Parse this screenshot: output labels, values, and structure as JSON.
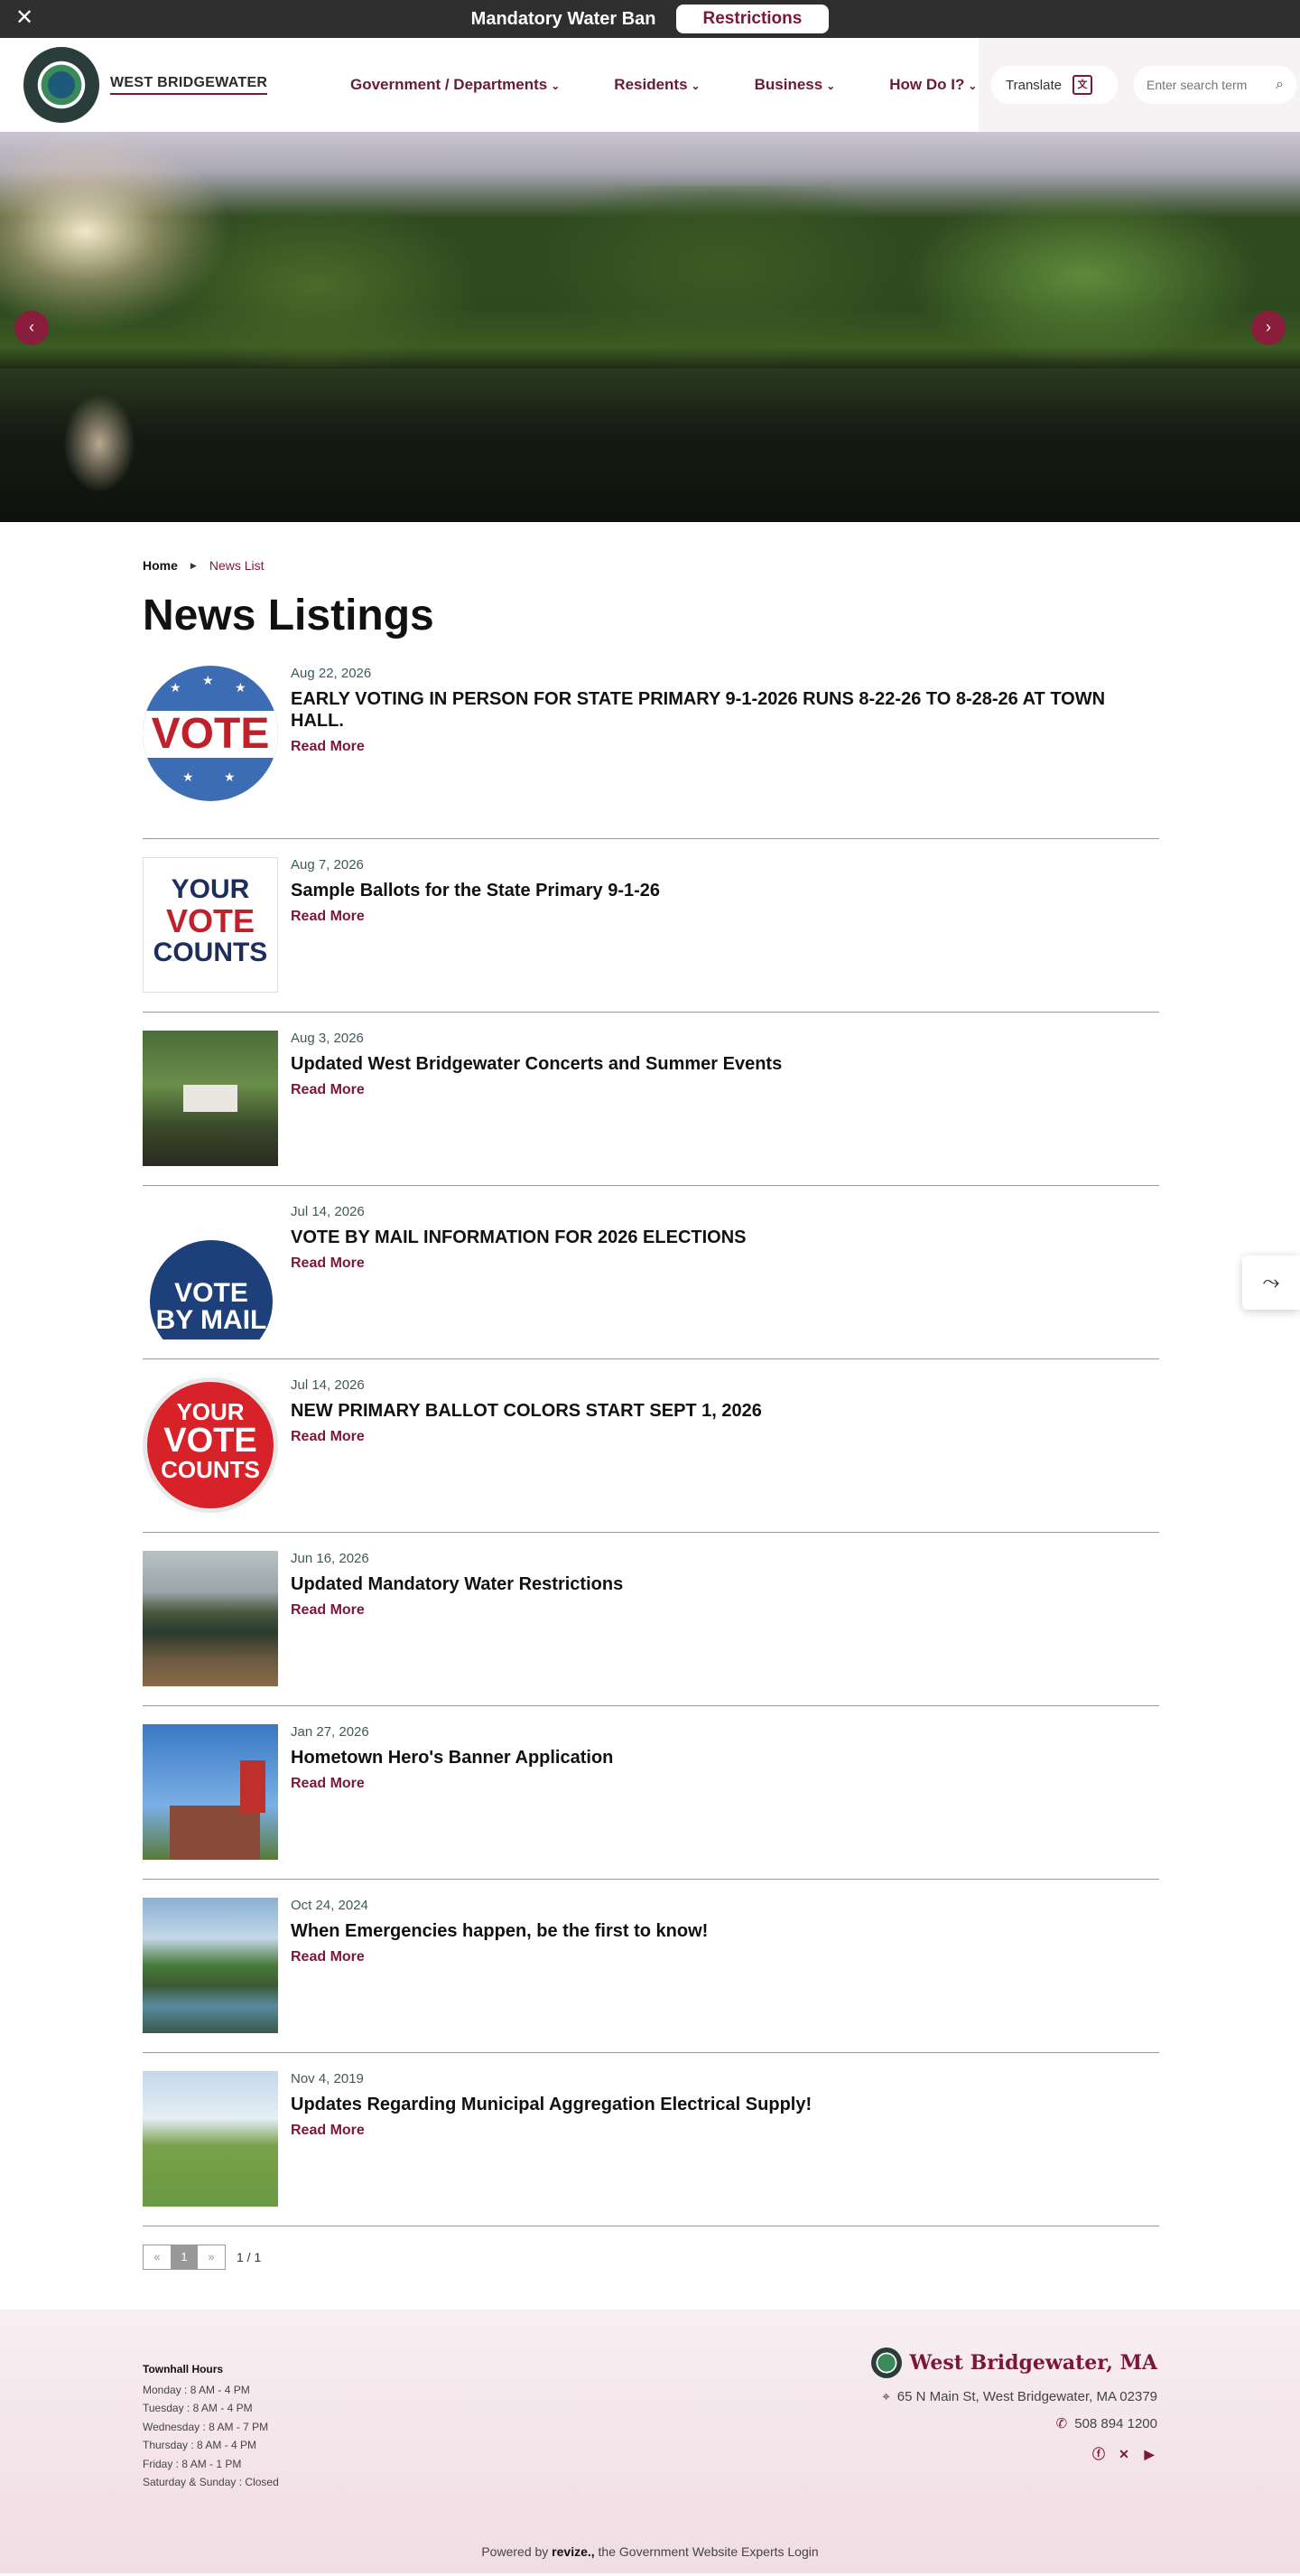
{
  "alert": {
    "title": "Mandatory Water Ban",
    "button": "Restrictions",
    "close": "✕"
  },
  "header": {
    "site_name": "WEST BRIDGEWATER",
    "nav": [
      "Government / Departments",
      "Residents",
      "Business",
      "How Do I?"
    ],
    "translate": "Translate",
    "search_placeholder": "Enter search term"
  },
  "breadcrumb": {
    "home": "Home",
    "current": "News List"
  },
  "page_title": "News Listings",
  "read_more": "Read More",
  "news": [
    {
      "date": "Aug 22, 2026",
      "title": "EARLY VOTING IN PERSON FOR STATE PRIMARY 9-1-2026 RUNS 8-22-26 TO 8-28-26 AT TOWN HALL."
    },
    {
      "date": "Aug 7, 2026",
      "title": "Sample Ballots for the State Primary 9-1-26"
    },
    {
      "date": "Aug 3, 2026",
      "title": "Updated West Bridgewater Concerts and Summer Events"
    },
    {
      "date": "Jul 14, 2026",
      "title": "VOTE BY MAIL INFORMATION FOR 2026 ELECTIONS"
    },
    {
      "date": "Jul 14, 2026",
      "title": "NEW PRIMARY BALLOT COLORS START SEPT 1, 2026"
    },
    {
      "date": "Jun 16, 2026",
      "title": "Updated Mandatory Water Restrictions"
    },
    {
      "date": "Jan 27, 2026",
      "title": "Hometown Hero's Banner Application"
    },
    {
      "date": "Oct 24, 2024",
      "title": "When Emergencies happen, be the first to know!"
    },
    {
      "date": "Nov 4, 2019",
      "title": "Updates Regarding Municipal Aggregation Electrical Supply!"
    }
  ],
  "thumb_text": {
    "vote": "VOTE",
    "counts": [
      "YOUR",
      "VOTE",
      "COUNTS"
    ],
    "mail": [
      "VOTE",
      "BY MAIL"
    ],
    "counts2": [
      "YOUR",
      "VOTE",
      "COUNTS"
    ]
  },
  "pager": {
    "prev": "«",
    "page": "1",
    "next": "»",
    "count": "1 / 1"
  },
  "footer": {
    "hours_title": "Townhall Hours",
    "hours": [
      "Monday : 8 AM - 4 PM",
      "Tuesday : 8 AM - 4 PM",
      "Wednesday : 8 AM - 7 PM",
      "Thursday : 8 AM - 4 PM",
      "Friday : 8 AM - 1 PM",
      "Saturday & Sunday : Closed"
    ],
    "brand": "West Bridgewater, MA",
    "address": "65 N Main St, West Bridgewater, MA 02379",
    "phone": "508 894 1200",
    "powered_prefix": "Powered by",
    "powered_brand": "revize.,",
    "powered_suffix": "the Government Website Experts Login"
  }
}
